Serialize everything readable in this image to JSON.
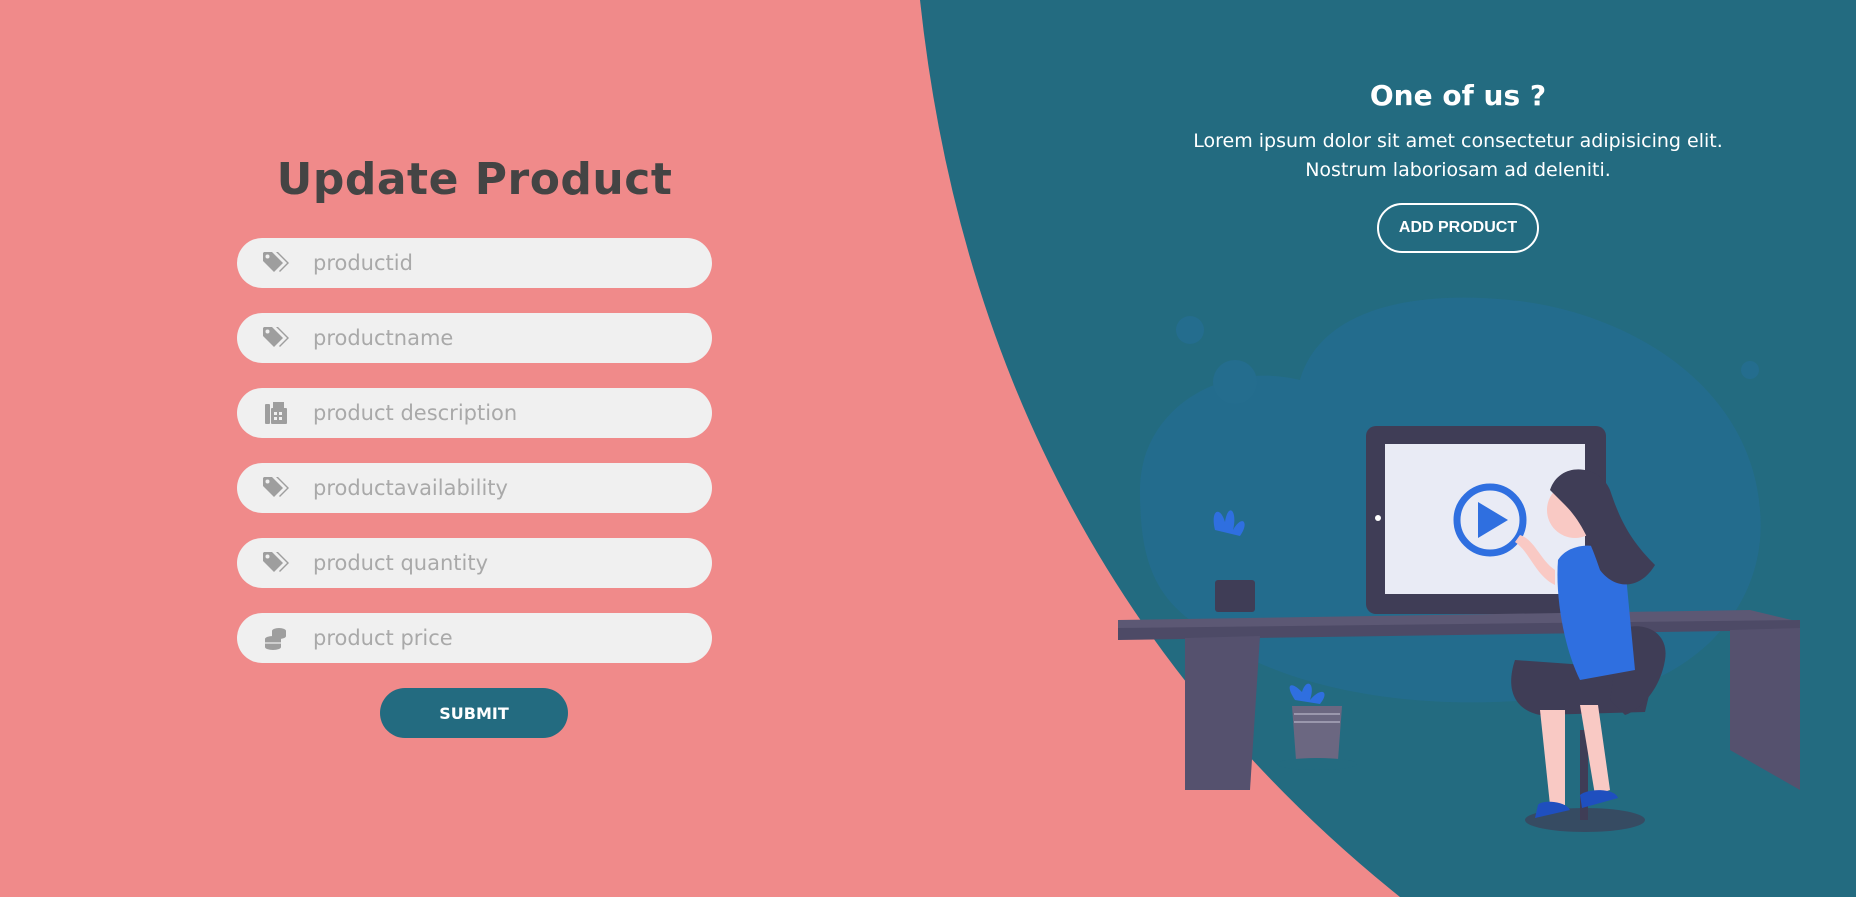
{
  "colors": {
    "left_background": "#f08a8a",
    "right_background": "#236b80",
    "form_title": "#444444",
    "input_background": "#f0f0f0",
    "icon_gray": "#9e9e9e",
    "button_primary": "#236b80",
    "accent_blue": "#2f6fe0"
  },
  "form": {
    "title": "Update Product",
    "fields": [
      {
        "icon": "tags-icon",
        "placeholder": "productid"
      },
      {
        "icon": "tags-icon",
        "placeholder": "productname"
      },
      {
        "icon": "fax-icon",
        "placeholder": "product description"
      },
      {
        "icon": "tags-icon",
        "placeholder": "productavailability"
      },
      {
        "icon": "tags-icon",
        "placeholder": "product quantity"
      },
      {
        "icon": "coins-icon",
        "placeholder": "product price"
      }
    ],
    "submit_label": "SUBMIT"
  },
  "cta": {
    "title": "One of us ?",
    "text": "Lorem ipsum dolor sit amet consectetur adipisicing elit. Nostrum laboriosam ad deleniti.",
    "button_label": "ADD PRODUCT"
  }
}
